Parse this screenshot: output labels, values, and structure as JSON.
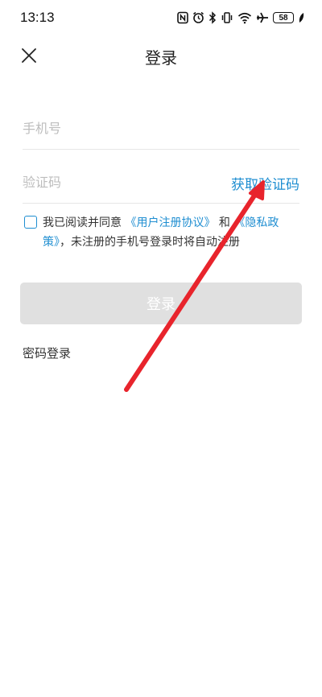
{
  "status_bar": {
    "time": "13:13",
    "battery": "58",
    "icons": [
      "nfc-icon",
      "alarm-icon",
      "bluetooth-icon",
      "vibrate-icon",
      "wifi-icon",
      "airplane-icon",
      "battery-icon",
      "leaf-icon"
    ]
  },
  "header": {
    "title": "登录",
    "close_icon": "close-icon"
  },
  "form": {
    "phone_placeholder": "手机号",
    "code_placeholder": "验证码",
    "get_code": "获取验证码"
  },
  "agreement": {
    "prefix": "我已阅读并同意",
    "user_agreement": "《用户注册协议》",
    "and": "和",
    "privacy_policy": "《隐私政策》",
    "suffix": "，未注册的手机号登录时将自动注册"
  },
  "login_button": "登录",
  "password_login": "密码登录",
  "colors": {
    "accent": "#1f8ed1",
    "button_disabled": "#e0e0e0",
    "annotation_arrow": "#e8242c"
  }
}
